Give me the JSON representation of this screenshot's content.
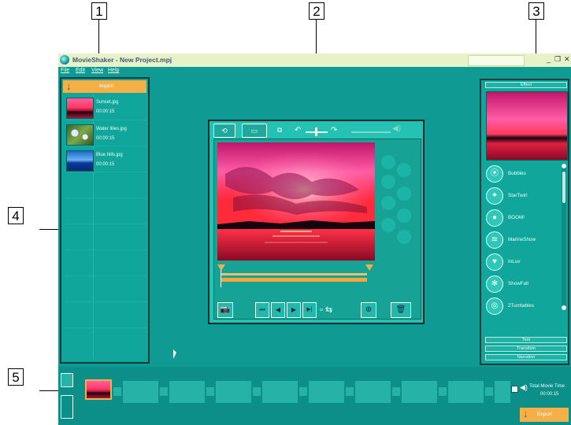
{
  "callouts": {
    "c1": "1",
    "c2": "2",
    "c3": "3",
    "c4": "4",
    "c5": "5"
  },
  "window": {
    "title": "MovieShaker - New Project.mpj",
    "buttons": {
      "minimize": "_",
      "restore": "❐",
      "close": "✕"
    }
  },
  "menu": {
    "file": "File",
    "edit": "Edit",
    "view": "View",
    "help": "Help"
  },
  "left_panel": {
    "import_label": "Import",
    "clips": [
      {
        "name": "Sunset.jpg",
        "duration": "00:00:15"
      },
      {
        "name": "Water lilies.jpg",
        "duration": "00:00:15"
      },
      {
        "name": "Blue hills.jpg",
        "duration": "00:00:15"
      }
    ]
  },
  "viewer": {
    "tabs": [
      "⟲",
      "▭",
      "⧉"
    ],
    "controls": {
      "camera": "📷",
      "rewind": "⏮",
      "prev": "◀",
      "play": "▶",
      "next": "▶|",
      "target": "⊕",
      "trash": "🗑"
    }
  },
  "right_panel": {
    "effect_label": "Effect",
    "effects": [
      {
        "name": "Bubbles",
        "icon": "bubbles-icon",
        "glyph": "⦿"
      },
      {
        "name": "StarTwirl",
        "icon": "star-icon",
        "glyph": "✦"
      },
      {
        "name": "BOOM!",
        "icon": "bomb-icon",
        "glyph": "●"
      },
      {
        "name": "MarineShow",
        "icon": "marine-icon",
        "glyph": "≋"
      },
      {
        "name": "InLuv",
        "icon": "heart-icon",
        "glyph": "♥"
      },
      {
        "name": "ShowFall",
        "icon": "snow-icon",
        "glyph": "✻"
      },
      {
        "name": "2Turntables",
        "icon": "turntable-icon",
        "glyph": "◎"
      }
    ],
    "text_label": "Text",
    "transition_label": "Transition",
    "narration_label": "Narration"
  },
  "timeline": {
    "total_label": "Total Movie Time",
    "total_time": "00:00:15",
    "export_label": "Export"
  },
  "colors": {
    "accent": "#f4b046",
    "panel": "#10a69c",
    "background": "#0f9a93"
  }
}
